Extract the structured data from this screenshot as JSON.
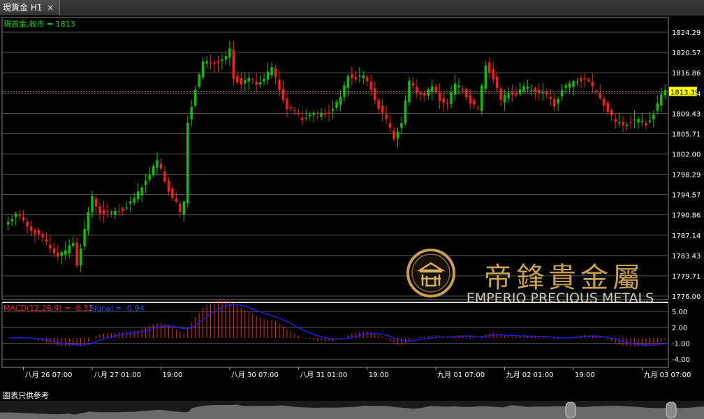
{
  "tab": {
    "title": "現貨金 H1",
    "close": "×"
  },
  "footer": {
    "note": "圖表只供參考"
  },
  "watermark": {
    "cn": "帝鋒貴金屬",
    "en": "EMPERIO PRECIOUS METALS"
  },
  "colors": {
    "bull": "#00c800",
    "bear": "#ff1a1a",
    "grid": "#555555",
    "axis_text": "#ffffff",
    "price_line": "#c8a000",
    "macd": "#ff2020",
    "signal": "#2020ff",
    "gold": "#c8a050"
  },
  "chart_data": [
    {
      "type": "candlestick",
      "title": "現貨金,收市 = 1813",
      "ylim": [
        1776.0,
        1824.29
      ],
      "yticks": [
        "1824.29",
        "1820.57",
        "1816.86",
        "1813.14",
        "1809.43",
        "1805.71",
        "1802.00",
        "1798.29",
        "1794.57",
        "1790.86",
        "1787.14",
        "1783.43",
        "1779.71",
        "1776.00"
      ],
      "current_price": 1813.39,
      "current_price_label": "1813.39",
      "x_labels": [
        "八月 26 07:00",
        "八月 27 01:00",
        "19:00",
        "八月 30 07:00",
        "八月 31 01:00",
        "19:00",
        "九月 01 07:00",
        "九月 02 01:00",
        "19:00",
        "九月 03 07:00"
      ],
      "x_label_index": [
        4,
        22,
        40,
        58,
        76,
        94,
        112,
        130,
        148,
        166
      ],
      "n_bars": 173,
      "anchors": [
        [
          0,
          1790.0
        ],
        [
          2,
          1790.8
        ],
        [
          5,
          1789.0
        ],
        [
          8,
          1787.0
        ],
        [
          11,
          1785.0
        ],
        [
          13,
          1783.5
        ],
        [
          15,
          1784.0
        ],
        [
          17,
          1786.0
        ],
        [
          18,
          1782.0
        ],
        [
          20,
          1788.0
        ],
        [
          22,
          1794.0
        ],
        [
          24,
          1791.5
        ],
        [
          27,
          1791.0
        ],
        [
          30,
          1792.0
        ],
        [
          33,
          1793.5
        ],
        [
          36,
          1797.5
        ],
        [
          39,
          1800.5
        ],
        [
          40,
          1799.0
        ],
        [
          42,
          1795.5
        ],
        [
          44,
          1793.0
        ],
        [
          45,
          1791.0
        ],
        [
          46,
          1793.0
        ],
        [
          47,
          1808.0
        ],
        [
          49,
          1814.0
        ],
        [
          51,
          1818.5
        ],
        [
          53,
          1818.8
        ],
        [
          56,
          1819.0
        ],
        [
          57,
          1819.5
        ],
        [
          58,
          1821.0
        ],
        [
          59,
          1816.0
        ],
        [
          61,
          1815.0
        ],
        [
          63,
          1815.5
        ],
        [
          65,
          1815.0
        ],
        [
          67,
          1816.0
        ],
        [
          69,
          1817.5
        ],
        [
          71,
          1814.0
        ],
        [
          73,
          1810.5
        ],
        [
          75,
          1809.5
        ],
        [
          77,
          1808.5
        ],
        [
          79,
          1809.5
        ],
        [
          81,
          1809.0
        ],
        [
          83,
          1809.5
        ],
        [
          85,
          1810.5
        ],
        [
          87,
          1812.0
        ],
        [
          89,
          1816.5
        ],
        [
          91,
          1816.0
        ],
        [
          93,
          1816.0
        ],
        [
          95,
          1814.0
        ],
        [
          97,
          1810.5
        ],
        [
          99,
          1808.0
        ],
        [
          101,
          1805.0
        ],
        [
          103,
          1808.0
        ],
        [
          105,
          1815.0
        ],
        [
          107,
          1813.5
        ],
        [
          109,
          1813.0
        ],
        [
          111,
          1814.0
        ],
        [
          113,
          1812.0
        ],
        [
          115,
          1811.5
        ],
        [
          117,
          1814.5
        ],
        [
          119,
          1814.0
        ],
        [
          121,
          1811.5
        ],
        [
          123,
          1810.0
        ],
        [
          125,
          1818.5
        ],
        [
          127,
          1816.0
        ],
        [
          129,
          1811.5
        ],
        [
          131,
          1813.5
        ],
        [
          133,
          1813.0
        ],
        [
          135,
          1814.0
        ],
        [
          137,
          1814.0
        ],
        [
          139,
          1813.5
        ],
        [
          141,
          1812.5
        ],
        [
          143,
          1811.0
        ],
        [
          145,
          1814.0
        ],
        [
          147,
          1814.5
        ],
        [
          149,
          1815.5
        ],
        [
          151,
          1816.0
        ],
        [
          153,
          1814.0
        ],
        [
          155,
          1812.5
        ],
        [
          157,
          1810.0
        ],
        [
          159,
          1807.5
        ],
        [
          161,
          1807.5
        ],
        [
          163,
          1808.0
        ],
        [
          165,
          1808.0
        ],
        [
          167,
          1807.5
        ],
        [
          169,
          1809.5
        ],
        [
          171,
          1812.5
        ],
        [
          172,
          1813.39
        ]
      ]
    },
    {
      "type": "macd",
      "title": "MACD(12,26,9) = -0.32",
      "signal_label": "Signal = -0.94",
      "ylim": [
        -4.0,
        6.0
      ],
      "yticks": [
        "5.00",
        "2.00",
        "-1.00",
        "-4.00"
      ],
      "ytick_values": [
        5,
        2,
        -1,
        -4
      ]
    }
  ]
}
